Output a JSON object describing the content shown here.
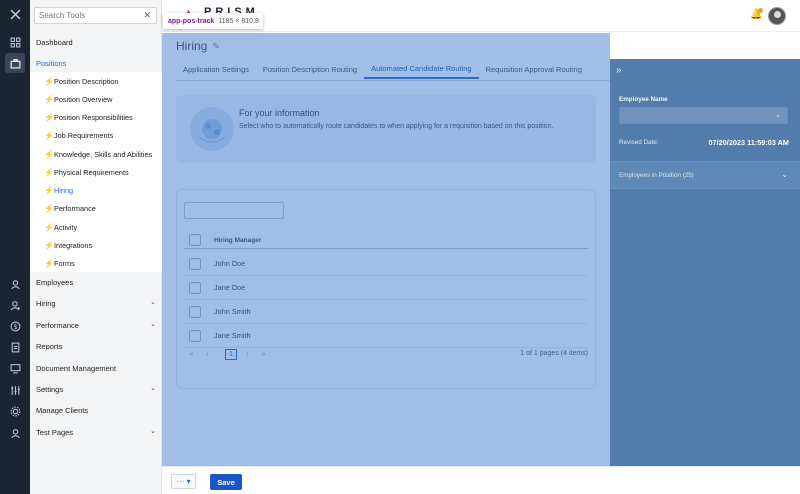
{
  "app": {
    "logo_text": "PRISM"
  },
  "inspector_tooltip": {
    "tag": "app-pos-track",
    "dims": "1185 × 810.8"
  },
  "rail": {
    "icons": [
      "close-icon",
      "dashboard-grid-icon",
      "briefcase-icon",
      "user-icon",
      "user-settings-icon",
      "dollar-icon",
      "document-icon",
      "monitor-icon",
      "tools-icon",
      "gear-icon",
      "account-icon"
    ]
  },
  "sidebar": {
    "search": {
      "placeholder": "Search Tools",
      "value": ""
    },
    "items": [
      {
        "label": "Dashboard"
      },
      {
        "label": "Positions"
      }
    ],
    "sub_items": [
      {
        "label": "Position Description"
      },
      {
        "label": "Position Overview"
      },
      {
        "label": "Position Responsibilities"
      },
      {
        "label": "Job Requirements"
      },
      {
        "label": "Knowledge, Skills and Abilities"
      },
      {
        "label": "Physical Requirements"
      },
      {
        "label": "Hiring"
      },
      {
        "label": "Performance"
      },
      {
        "label": "Activity"
      },
      {
        "label": "Integrations"
      },
      {
        "label": "Forms"
      }
    ],
    "bottom_items": [
      {
        "label": "Employees"
      },
      {
        "label": "Hiring"
      },
      {
        "label": "Performance"
      },
      {
        "label": "Reports"
      },
      {
        "label": "Document Management"
      },
      {
        "label": "Settings"
      },
      {
        "label": "Manage Clients"
      },
      {
        "label": "Test Pages"
      }
    ]
  },
  "main": {
    "title": "Hiring",
    "tabs": [
      {
        "label": "Application Settings"
      },
      {
        "label": "Position Description Routing"
      },
      {
        "label": "Automated Candidate Routing"
      },
      {
        "label": "Requisition Approval Routing"
      }
    ],
    "info": {
      "title": "For your information",
      "text": "Select who to automatically route candidates to when applying for a requisition based on this position."
    },
    "grid": {
      "search_placeholder": "",
      "column": "Hiring Manager",
      "rows": [
        "John Doe",
        "Jane Doe",
        "John Smith",
        "Jane Smith"
      ],
      "page": "1",
      "page_info": "1 of 1 pages (4 items)"
    }
  },
  "drawer": {
    "employee_name_label": "Employee Name",
    "employee_name_value": "",
    "revised_label": "Revised Date:",
    "revised_value": "07/20/2023 11:59:03 AM",
    "accordion_label": "Employees in Position (25)"
  },
  "footer": {
    "more_label": "··· ▾",
    "save_label": "Save"
  },
  "colors": {
    "rail": "#1c2433",
    "accent": "#2d6ad3",
    "save": "#1a56c9",
    "drawer": "#527dab"
  }
}
